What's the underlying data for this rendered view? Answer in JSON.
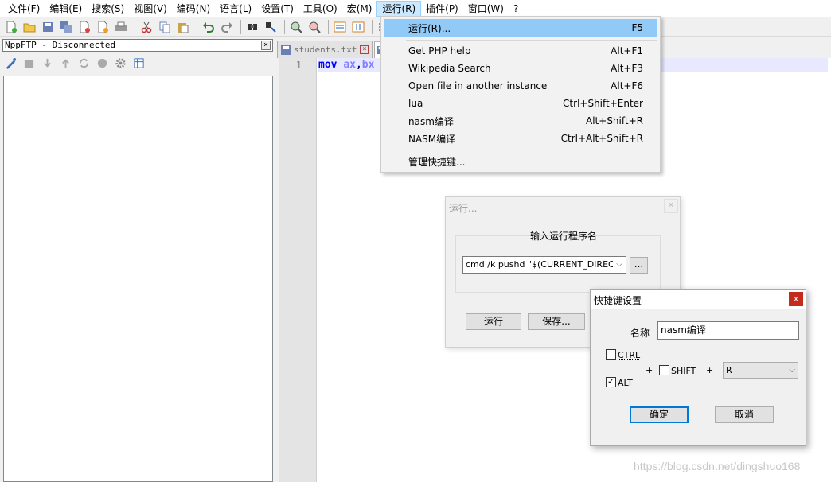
{
  "menubar": {
    "items": [
      {
        "label": "文件(F)"
      },
      {
        "label": "编辑(E)"
      },
      {
        "label": "搜索(S)"
      },
      {
        "label": "视图(V)"
      },
      {
        "label": "编码(N)"
      },
      {
        "label": "语言(L)"
      },
      {
        "label": "设置(T)"
      },
      {
        "label": "工具(O)"
      },
      {
        "label": "宏(M)"
      },
      {
        "label": "运行(R)"
      },
      {
        "label": "插件(P)"
      },
      {
        "label": "窗口(W)"
      },
      {
        "label": "?"
      }
    ],
    "active_index": 9
  },
  "ftp": {
    "title": "NppFTP - Disconnected"
  },
  "tabs": [
    {
      "label": "students.txt"
    }
  ],
  "editor": {
    "line_number": "1",
    "code": {
      "kw": "mov",
      "reg1": "ax",
      "comma": ",",
      "reg2": "bx"
    }
  },
  "run_menu": {
    "items": [
      {
        "label": "运行(R)...",
        "shortcut": "F5"
      },
      {
        "label": "Get PHP help",
        "shortcut": "Alt+F1"
      },
      {
        "label": "Wikipedia Search",
        "shortcut": "Alt+F3"
      },
      {
        "label": "Open file in another instance",
        "shortcut": "Alt+F6"
      },
      {
        "label": "lua",
        "shortcut": "Ctrl+Shift+Enter"
      },
      {
        "label": "nasm编译",
        "shortcut": "Alt+Shift+R"
      },
      {
        "label": "NASM编译",
        "shortcut": "Ctrl+Alt+Shift+R"
      },
      {
        "label": "管理快捷键...",
        "shortcut": ""
      }
    ]
  },
  "run_dialog": {
    "title": "运行...",
    "group_label": "输入运行程序名",
    "command": "cmd /k pushd \"$(CURRENT_DIRECTORY)\"",
    "browse_label": "...",
    "run_label": "运行",
    "save_label": "保存..."
  },
  "shortcut_dialog": {
    "title": "快捷键设置",
    "close_label": "x",
    "name_label": "名称",
    "name_value": "nasm编译",
    "ctrl_label": "CTRL",
    "ctrl_checked": false,
    "alt_label": "ALT",
    "alt_checked": true,
    "shift_label": "SHIFT",
    "shift_checked": false,
    "plus": "+",
    "key_value": "R",
    "ok_label": "确定",
    "cancel_label": "取消"
  },
  "watermark": "https://blog.csdn.net/dingshuo168",
  "colors": {
    "menu_highlight": "#91c9f7",
    "close_red": "#c42b1c",
    "keyword": "#0000ff",
    "register": "#8080ff"
  }
}
